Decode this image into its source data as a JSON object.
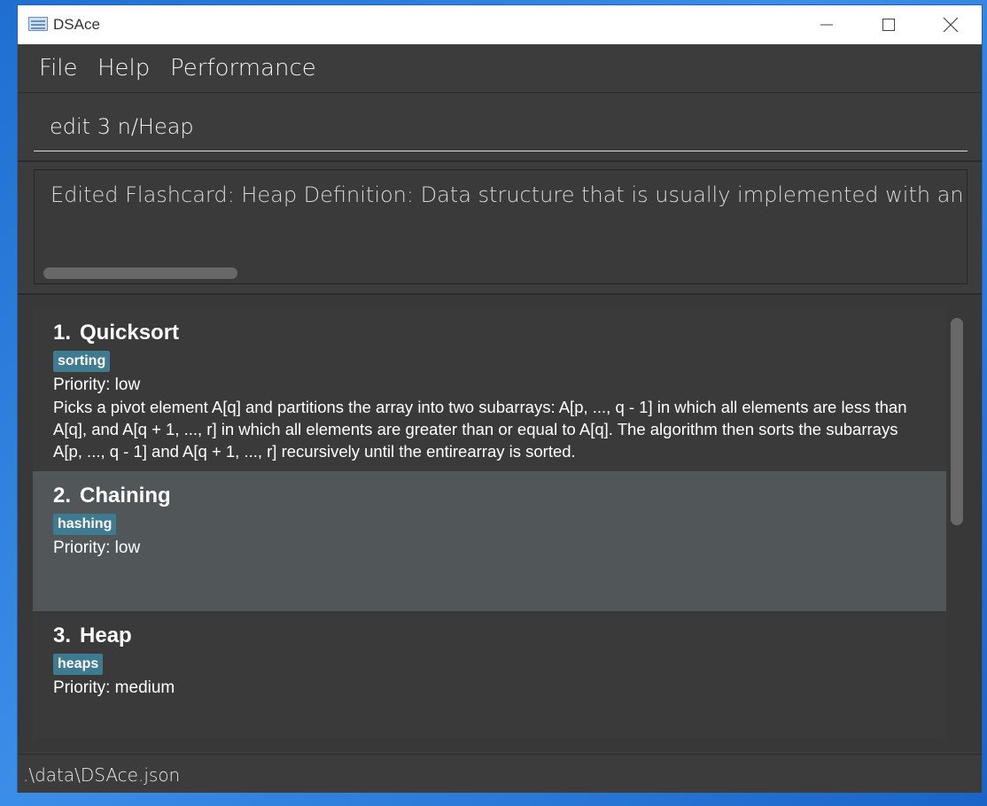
{
  "window": {
    "title": "DSAce"
  },
  "menu": {
    "file": "File",
    "help": "Help",
    "performance": "Performance"
  },
  "command": {
    "value": "edit 3 n/Heap",
    "placeholder": ""
  },
  "result": {
    "text": "Edited Flashcard: Heap Definition: Data structure that is usually implemented with an array, and"
  },
  "flashcards": [
    {
      "index": "1.",
      "title": "Quicksort",
      "tag": "sorting",
      "priority": "Priority: low",
      "definition": "Picks a pivot element A[q] and partitions the array into two subarrays: A[p, ..., q - 1] in which all elements are less than A[q], and A[q + 1, ..., r] in which all elements are greater than or equal to A[q]. The algorithm then sorts the subarrays A[p, ..., q - 1] and A[q + 1, ..., r] recursively until the entirearray is sorted."
    },
    {
      "index": "2.",
      "title": "Chaining",
      "tag": "hashing",
      "priority": "Priority: low"
    },
    {
      "index": "3.",
      "title": "Heap",
      "tag": "heaps",
      "priority": "Priority: medium"
    }
  ],
  "status": {
    "path": ".\\data\\DSAce.json"
  },
  "colors": {
    "background": "#3c3c3c",
    "selected_card": "#515658",
    "tag": "#3e7b91"
  }
}
